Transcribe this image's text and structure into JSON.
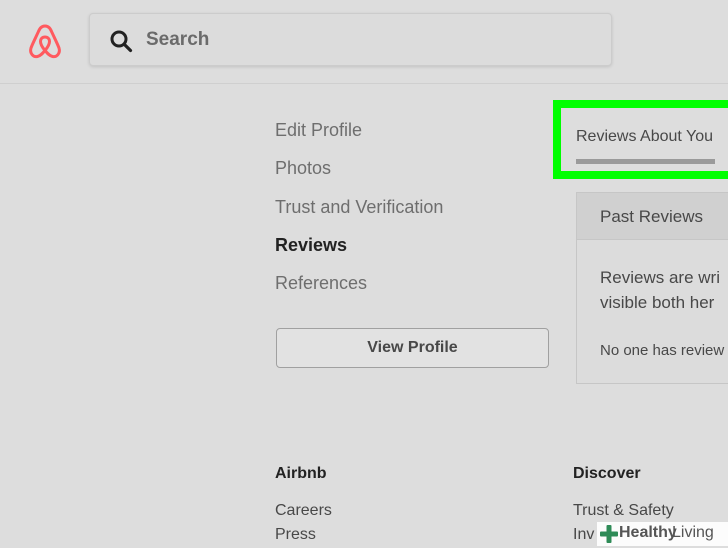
{
  "colors": {
    "brand": "#ff5a5f",
    "highlight": "#00ff00",
    "background": "#dddddd"
  },
  "header": {
    "logo_icon": "airbnb-logo-icon",
    "search_icon": "search-icon",
    "search_placeholder": "Search"
  },
  "side_nav": {
    "items": [
      {
        "label": "Edit Profile",
        "active": false
      },
      {
        "label": "Photos",
        "active": false
      },
      {
        "label": "Trust and Verification",
        "active": false
      },
      {
        "label": "Reviews",
        "active": true
      },
      {
        "label": "References",
        "active": false
      }
    ],
    "view_profile_label": "View Profile"
  },
  "reviews": {
    "tab_label": "Reviews About You",
    "card_title": "Past Reviews",
    "description_line1": "Reviews are wri",
    "description_line2": "visible both her",
    "empty_text": "No one has review"
  },
  "footer": {
    "airbnb": {
      "title": "Airbnb",
      "links": [
        "Careers",
        "Press"
      ]
    },
    "discover": {
      "title": "Discover",
      "links": [
        "Trust & Safety",
        "Inv"
      ]
    }
  },
  "watermark": {
    "icon": "plus-cross-icon",
    "text_bold": "Healthy",
    "text_regular": "Living"
  }
}
